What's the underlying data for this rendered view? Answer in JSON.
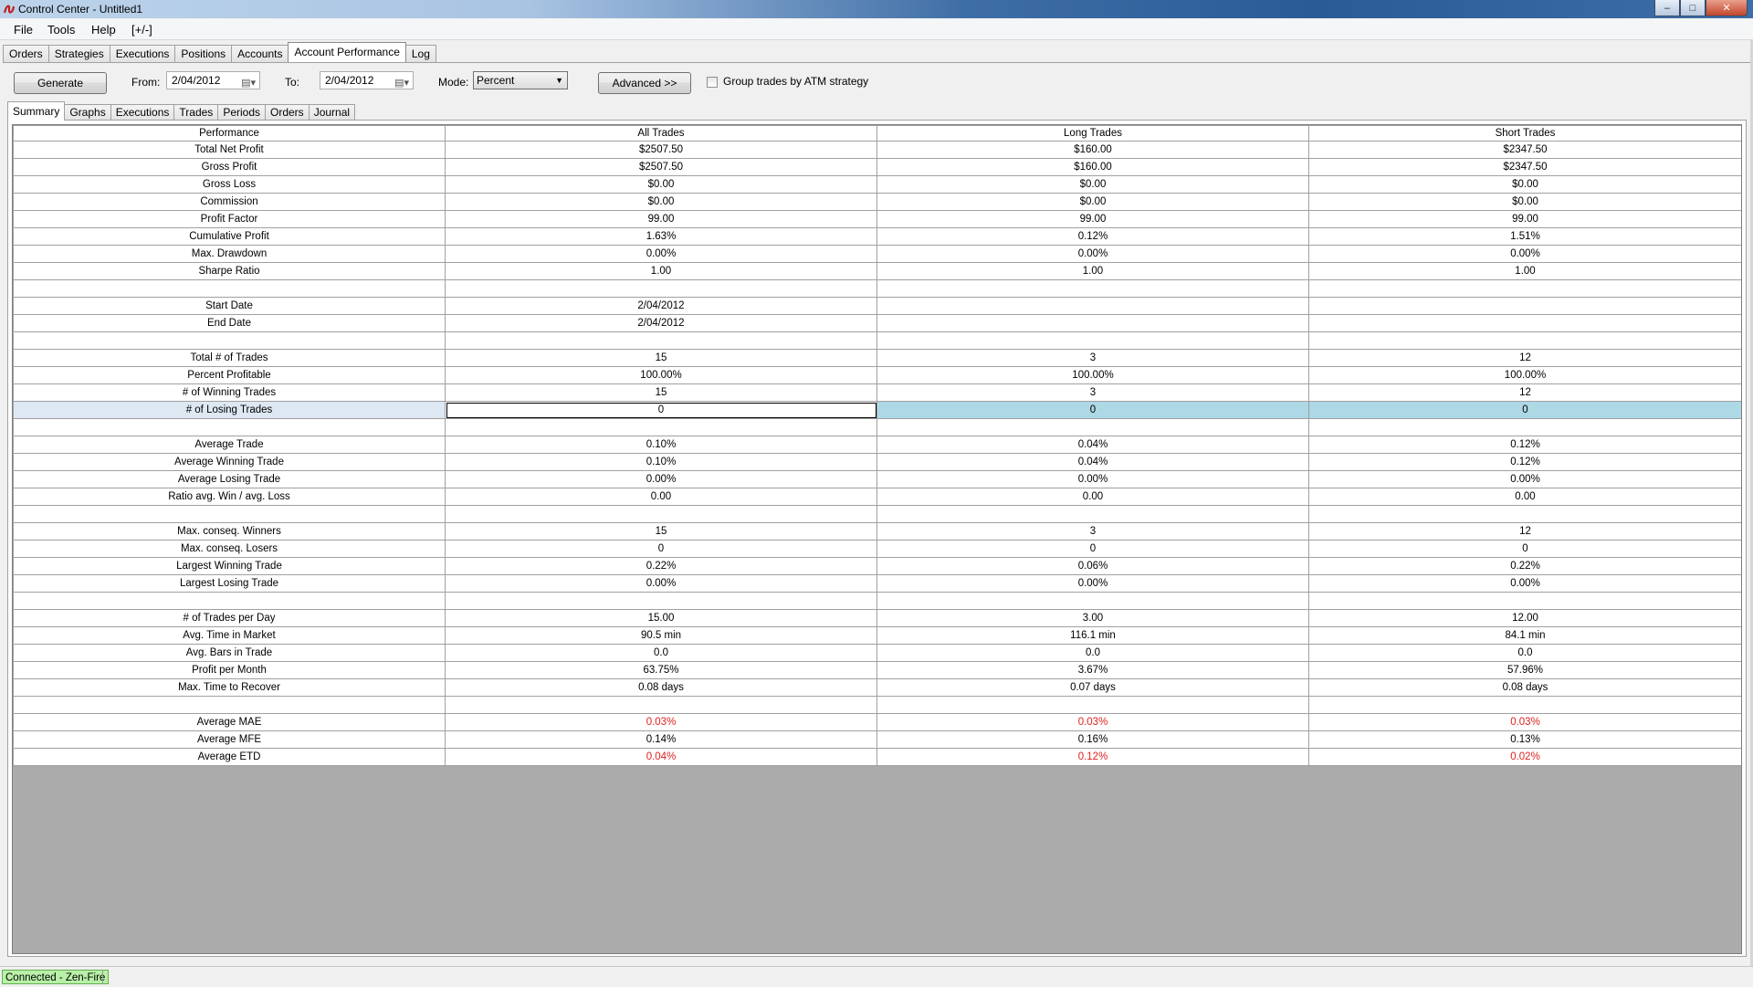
{
  "window": {
    "title": "Control Center - Untitled1",
    "min_glyph": "–",
    "max_glyph": "□",
    "close_glyph": "✕"
  },
  "menu": {
    "file": "File",
    "tools": "Tools",
    "help": "Help",
    "toggle": "[+/-]"
  },
  "main_tabs": [
    "Orders",
    "Strategies",
    "Executions",
    "Positions",
    "Accounts",
    "Account Performance",
    "Log"
  ],
  "toolbar": {
    "generate_label": "Generate",
    "from_label": "From:",
    "from_value": "2/04/2012",
    "to_label": "To:",
    "to_value": "2/04/2012",
    "mode_label": "Mode:",
    "mode_value": "Percent",
    "advanced_label": "Advanced >>",
    "group_label": "Group trades by ATM strategy",
    "group_checked": false
  },
  "sub_tabs": [
    "Summary",
    "Graphs",
    "Executions",
    "Trades",
    "Periods",
    "Orders",
    "Journal"
  ],
  "table": {
    "headers": [
      "Performance",
      "All Trades",
      "Long Trades",
      "Short Trades"
    ],
    "rows": [
      [
        "Total Net Profit",
        "$2507.50",
        "$160.00",
        "$2347.50"
      ],
      [
        "Gross Profit",
        "$2507.50",
        "$160.00",
        "$2347.50"
      ],
      [
        "Gross Loss",
        "$0.00",
        "$0.00",
        "$0.00"
      ],
      [
        "Commission",
        "$0.00",
        "$0.00",
        "$0.00"
      ],
      [
        "Profit Factor",
        "99.00",
        "99.00",
        "99.00"
      ],
      [
        "Cumulative Profit",
        "1.63%",
        "0.12%",
        "1.51%"
      ],
      [
        "Max. Drawdown",
        "0.00%",
        "0.00%",
        "0.00%"
      ],
      [
        "Sharpe Ratio",
        "1.00",
        "1.00",
        "1.00"
      ],
      [
        "",
        "",
        "",
        ""
      ],
      [
        "Start Date",
        "2/04/2012",
        "",
        ""
      ],
      [
        "End Date",
        "2/04/2012",
        "",
        ""
      ],
      [
        "",
        "",
        "",
        ""
      ],
      [
        "Total # of Trades",
        "15",
        "3",
        "12"
      ],
      [
        "Percent Profitable",
        "100.00%",
        "100.00%",
        "100.00%"
      ],
      [
        "# of Winning Trades",
        "15",
        "3",
        "12"
      ],
      [
        "# of Losing Trades",
        "0",
        "0",
        "0"
      ],
      [
        "",
        "",
        "",
        ""
      ],
      [
        "Average Trade",
        "0.10%",
        "0.04%",
        "0.12%"
      ],
      [
        "Average Winning Trade",
        "0.10%",
        "0.04%",
        "0.12%"
      ],
      [
        "Average Losing Trade",
        "0.00%",
        "0.00%",
        "0.00%"
      ],
      [
        "Ratio avg. Win / avg. Loss",
        "0.00",
        "0.00",
        "0.00"
      ],
      [
        "",
        "",
        "",
        ""
      ],
      [
        "Max. conseq. Winners",
        "15",
        "3",
        "12"
      ],
      [
        "Max. conseq. Losers",
        "0",
        "0",
        "0"
      ],
      [
        "Largest Winning Trade",
        "0.22%",
        "0.06%",
        "0.22%"
      ],
      [
        "Largest Losing Trade",
        "0.00%",
        "0.00%",
        "0.00%"
      ],
      [
        "",
        "",
        "",
        ""
      ],
      [
        "# of Trades per Day",
        "15.00",
        "3.00",
        "12.00"
      ],
      [
        "Avg. Time in Market",
        "90.5 min",
        "116.1 min",
        "84.1 min"
      ],
      [
        "Avg. Bars in Trade",
        "0.0",
        "0.0",
        "0.0"
      ],
      [
        "Profit per Month",
        "63.75%",
        "3.67%",
        "57.96%"
      ],
      [
        "Max. Time to Recover",
        "0.08 days",
        "0.07 days",
        "0.08 days"
      ],
      [
        "",
        "",
        "",
        ""
      ],
      [
        "Average MAE",
        "0.03%",
        "0.03%",
        "0.03%"
      ],
      [
        "Average MFE",
        "0.14%",
        "0.16%",
        "0.13%"
      ],
      [
        "Average ETD",
        "0.04%",
        "0.12%",
        "0.02%"
      ]
    ],
    "negative_rows": [
      "Average MAE",
      "Average ETD"
    ],
    "selected_row": "# of Losing Trades"
  },
  "status": {
    "connection": "Connected - Zen-Fire"
  },
  "colors": {
    "negative": "#e02020",
    "selected": "#add8e6",
    "connected": "#b9f0a8",
    "empty_area": "#ababab"
  }
}
